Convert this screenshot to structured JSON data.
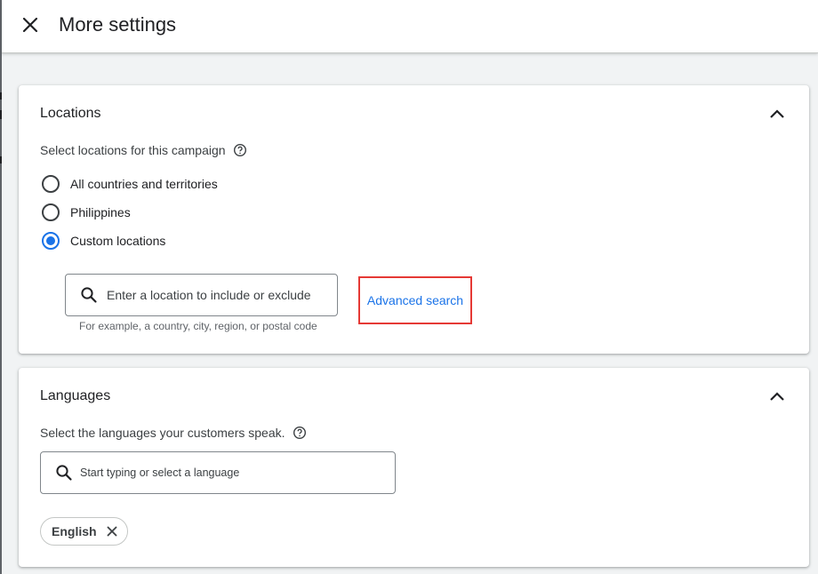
{
  "header": {
    "title": "More settings",
    "close_icon": "close-icon"
  },
  "locations": {
    "title": "Locations",
    "subtitle": "Select locations for this campaign",
    "options": [
      {
        "label": "All countries and territories",
        "selected": false
      },
      {
        "label": "Philippines",
        "selected": false
      },
      {
        "label": "Custom locations",
        "selected": true
      }
    ],
    "search": {
      "placeholder": "Enter a location to include or exclude",
      "helper": "For example, a country, city, region, or postal code"
    },
    "advanced_search_label": "Advanced search"
  },
  "languages": {
    "title": "Languages",
    "subtitle": "Select the languages your customers speak.",
    "search_placeholder": "Start typing or select a language",
    "selected_chips": [
      {
        "label": "English"
      }
    ]
  },
  "colors": {
    "accent": "#1a73e8",
    "highlight_border": "#e53935"
  }
}
